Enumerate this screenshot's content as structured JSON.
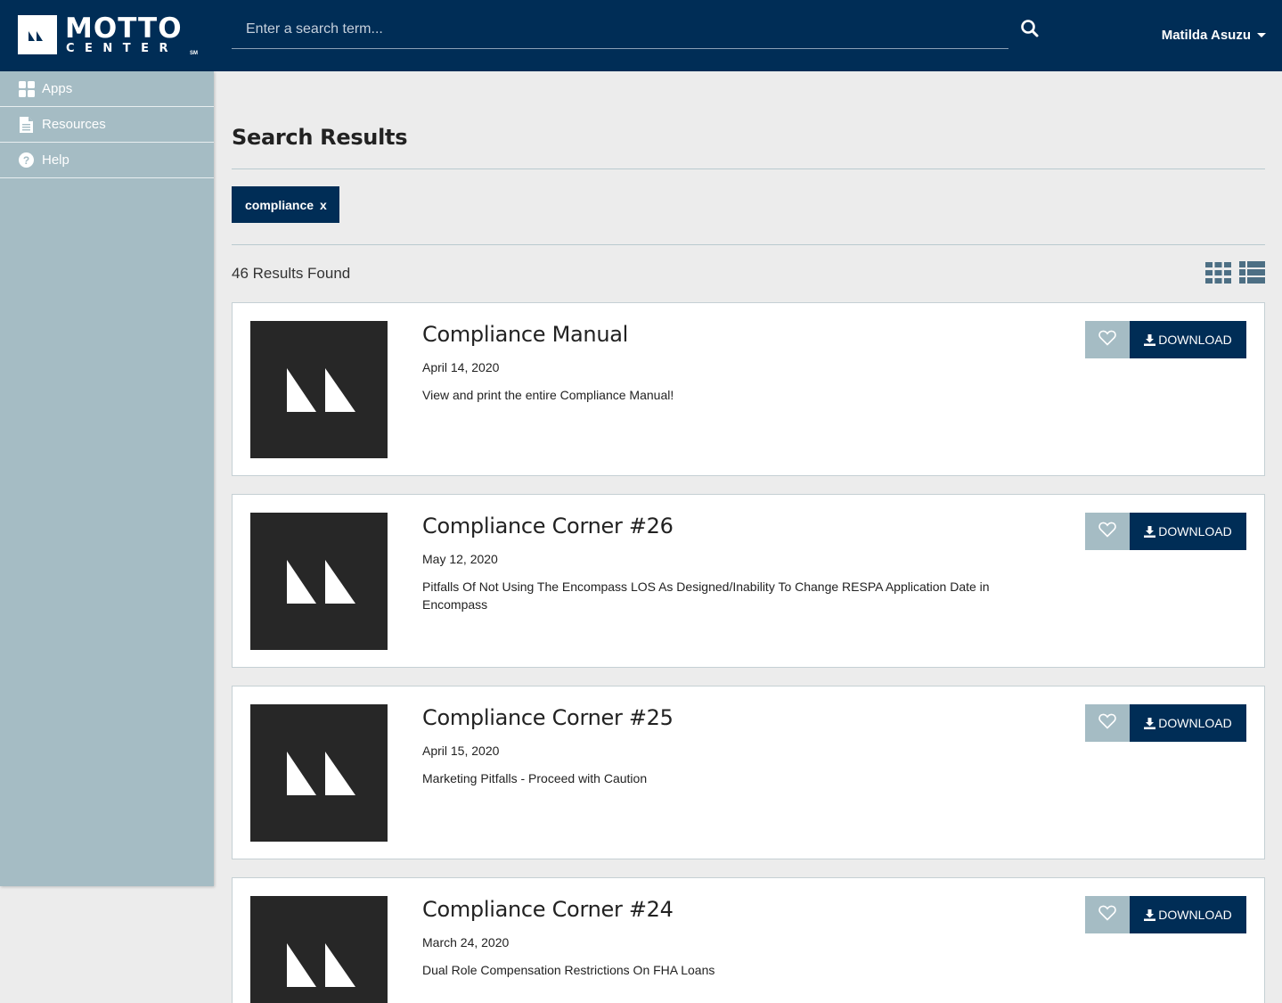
{
  "header": {
    "logo_word": "MOTTO",
    "logo_sub": "CENTER",
    "logo_mark": "SM",
    "search_placeholder": "Enter a search term...",
    "user_name": "Matilda Asuzu",
    "brand_color": "#002d56"
  },
  "sidebar": {
    "items": [
      {
        "label": "Apps",
        "icon": "grid-icon"
      },
      {
        "label": "Resources",
        "icon": "document-icon"
      },
      {
        "label": "Help",
        "icon": "question-circle-icon"
      }
    ]
  },
  "main": {
    "title": "Search Results",
    "filter_chip": {
      "label": "compliance",
      "remove": "x"
    },
    "results_count": "46 Results Found",
    "results": [
      {
        "title": "Compliance Manual",
        "date": "April 14, 2020",
        "description": "View and print the entire Compliance Manual!",
        "download_label": "DOWNLOAD"
      },
      {
        "title": "Compliance Corner #26",
        "date": "May 12, 2020",
        "description": "Pitfalls Of Not Using The Encompass LOS As Designed/Inability To Change RESPA Application Date in Encompass",
        "download_label": "DOWNLOAD"
      },
      {
        "title": "Compliance Corner #25",
        "date": "April 15, 2020",
        "description": "Marketing Pitfalls - Proceed with Caution",
        "download_label": "DOWNLOAD"
      },
      {
        "title": "Compliance Corner #24",
        "date": "March 24, 2020",
        "description": "Dual Role Compensation Restrictions On FHA Loans",
        "download_label": "DOWNLOAD"
      }
    ]
  }
}
